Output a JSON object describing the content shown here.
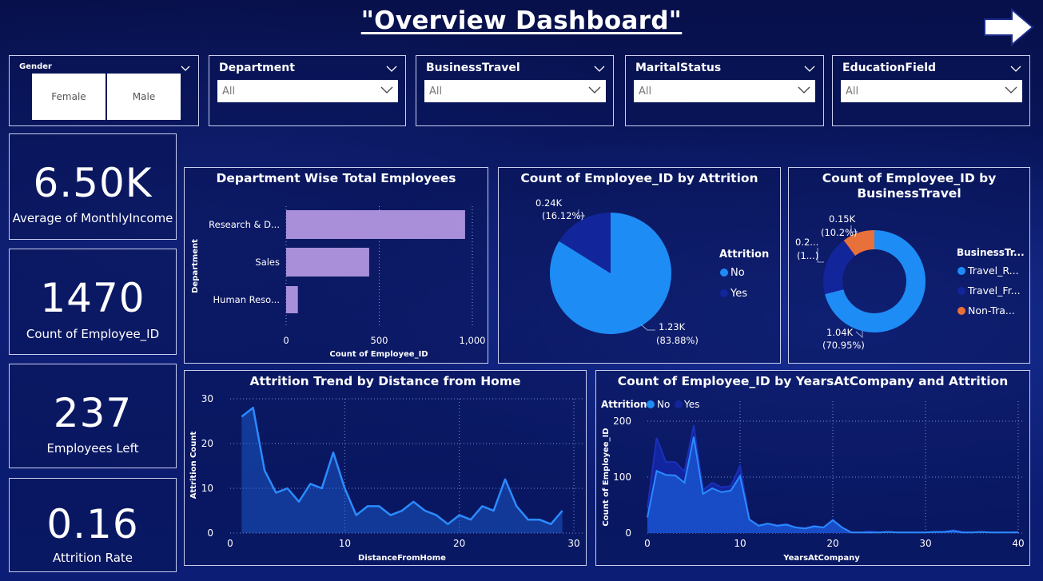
{
  "header": {
    "title": "\"Overview Dashboard\""
  },
  "icons": {
    "nav": "right-arrow-icon",
    "dropdown": "chevron-down-icon"
  },
  "slicers": {
    "gender": {
      "label": "Gender",
      "options": [
        "Female",
        "Male"
      ]
    },
    "department": {
      "label": "Department",
      "value": "All"
    },
    "business_travel": {
      "label": "BusinessTravel",
      "value": "All"
    },
    "marital_status": {
      "label": "MaritalStatus",
      "value": "All"
    },
    "education_field": {
      "label": "EducationField",
      "value": "All"
    }
  },
  "kpis": [
    {
      "value": "6.50K",
      "label": "Average of MonthlyIncome"
    },
    {
      "value": "1470",
      "label": "Count of Employee_ID"
    },
    {
      "value": "237",
      "label": "Employees Left"
    },
    {
      "value": "0.16",
      "label": "Attrition Rate"
    }
  ],
  "colors": {
    "bar": "#a98fd9",
    "no": "#1e8cf5",
    "yes": "#13259a",
    "non_travel": "#e8703a",
    "line": "#2b8bff"
  },
  "chart_data": [
    {
      "type": "bar",
      "title": "Department Wise Total Employees",
      "categories": [
        "Research & D...",
        "Sales",
        "Human Reso..."
      ],
      "values": [
        961,
        446,
        63
      ],
      "xlabel": "Count of Employee_ID",
      "ylabel": "Department",
      "xlim": [
        0,
        1000
      ],
      "xticks": [
        "0",
        "500",
        "1,000"
      ]
    },
    {
      "type": "pie",
      "title": "Count of Employee_ID by Attrition",
      "legend_title": "Attrition",
      "labels": [
        "No",
        "Yes"
      ],
      "values": [
        1233,
        237
      ],
      "data_labels": [
        [
          "1.23K",
          "(83.88%)"
        ],
        [
          "0.24K",
          "(16.12%)"
        ]
      ]
    },
    {
      "type": "pie",
      "title_lines": [
        "Count of Employee_ID by",
        "BusinessTravel"
      ],
      "legend_title": "BusinessTr...",
      "labels": [
        "Travel_R...",
        "Travel_Fr...",
        "Non-Tra..."
      ],
      "values": [
        1043,
        277,
        150
      ],
      "data_labels": [
        [
          "1.04K",
          "(70.95%)"
        ],
        [
          "0.2...",
          "(1...)"
        ],
        [
          "0.15K",
          "(10.2%)"
        ]
      ]
    },
    {
      "type": "area",
      "title": "Attrition Trend by Distance from Home",
      "xlabel": "DistanceFromHome",
      "ylabel": "Attrition Count",
      "xlim": [
        0,
        30
      ],
      "ylim": [
        0,
        30
      ],
      "xticks": [
        "0",
        "10",
        "20",
        "30"
      ],
      "yticks": [
        "0",
        "10",
        "20",
        "30"
      ],
      "x": [
        1,
        2,
        3,
        4,
        5,
        6,
        7,
        8,
        9,
        10,
        11,
        12,
        13,
        14,
        15,
        16,
        17,
        18,
        19,
        20,
        21,
        22,
        23,
        24,
        25,
        26,
        27,
        28,
        29
      ],
      "values": [
        26,
        28,
        14,
        9,
        10,
        7,
        11,
        10,
        18,
        10,
        4,
        6,
        6,
        4,
        5,
        7,
        5,
        4,
        2,
        4,
        3,
        6,
        5,
        12,
        6,
        3,
        3,
        2,
        5
      ]
    },
    {
      "type": "area",
      "title": "Count of Employee_ID by YearsAtCompany and Attrition",
      "legend_title": "Attrition",
      "xlabel": "YearsAtCompany",
      "ylabel": "Count of Employee_ID",
      "xlim": [
        0,
        40
      ],
      "ylim": [
        0,
        200
      ],
      "xticks": [
        "0",
        "10",
        "20",
        "30",
        "40"
      ],
      "yticks": [
        "0",
        "100",
        "200"
      ],
      "x": [
        0,
        1,
        2,
        3,
        4,
        5,
        6,
        7,
        8,
        9,
        10,
        11,
        12,
        13,
        14,
        15,
        16,
        17,
        18,
        19,
        20,
        21,
        22,
        23,
        24,
        25,
        26,
        27,
        28,
        29,
        30,
        31,
        32,
        33,
        34,
        35,
        36,
        37,
        38,
        39,
        40
      ],
      "series": [
        {
          "name": "No",
          "values": [
            28,
            111,
            104,
            103,
            90,
            172,
            70,
            80,
            73,
            76,
            102,
            24,
            13,
            17,
            13,
            15,
            10,
            8,
            12,
            10,
            23,
            10,
            1,
            1,
            1,
            1,
            2,
            1,
            1,
            1,
            1,
            2,
            2,
            4,
            1,
            1,
            2,
            1,
            1,
            1,
            1
          ]
        },
        {
          "name": "Yes",
          "values": [
            16,
            59,
            23,
            24,
            20,
            21,
            7,
            10,
            9,
            8,
            18,
            1,
            1,
            0,
            1,
            1,
            0,
            1,
            1,
            0,
            1,
            0,
            0,
            0,
            2,
            0,
            0,
            0,
            0,
            0,
            0,
            0,
            0,
            1,
            1,
            0,
            0,
            0,
            0,
            0,
            1
          ]
        }
      ]
    }
  ]
}
